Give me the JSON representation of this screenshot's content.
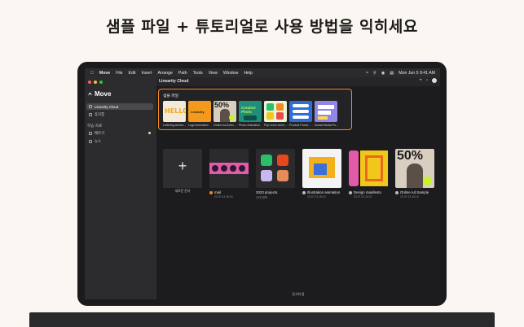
{
  "headline": "샘플 파일 + 튜토리얼로 사용 방법을 익히세요",
  "menubar": {
    "items": [
      "Move",
      "File",
      "Edit",
      "Insert",
      "Arrange",
      "Path",
      "Tools",
      "View",
      "Window",
      "Help"
    ],
    "datetime": "Mon Jun 5  9:41 AM"
  },
  "sidebar": {
    "logo": "Move",
    "items": [
      {
        "label": "Linearity Cloud",
        "icon": "cloud-icon"
      },
      {
        "label": "휴지통",
        "icon": "trash-icon"
      }
    ],
    "section_title": "학습 자료",
    "learn_items": [
      {
        "label": "배우기",
        "icon": "book-icon"
      },
      {
        "label": "뉴스",
        "icon": "news-icon"
      }
    ]
  },
  "main": {
    "title": "Linearity Cloud",
    "samples_title": "샘플 파일",
    "samples": [
      {
        "label": "Lettering Anima..."
      },
      {
        "label": "Logo Animation"
      },
      {
        "label": "Online Ad Anim..."
      },
      {
        "label": "Photo Animation"
      },
      {
        "label": "Pop Icons Anim..."
      },
      {
        "label": "Product Protot..."
      },
      {
        "label": "Social Media Po..."
      }
    ],
    "new_doc_label": "새로운 문서",
    "files": [
      {
        "title": "mail",
        "sub": "23.07.24 18:03"
      },
      {
        "title": "2023 projects",
        "sub": "23개 항목"
      },
      {
        "title": "Illustration animation",
        "sub": "23.07.24 18:10"
      },
      {
        "title": "Design manifesto",
        "sub": "23.07.24 20:07"
      },
      {
        "title": "Online Ad Sample",
        "sub": "23.07.24 20:10"
      }
    ],
    "status": "동기화 됨",
    "thumb_text": {
      "hello": "HELLO",
      "logo": "Linearity",
      "percent": "50%",
      "photo": "Creative Photo",
      "percent_big": "50%"
    }
  },
  "colors": {
    "accent": "#f08a24",
    "background": "#fbf6f1"
  }
}
